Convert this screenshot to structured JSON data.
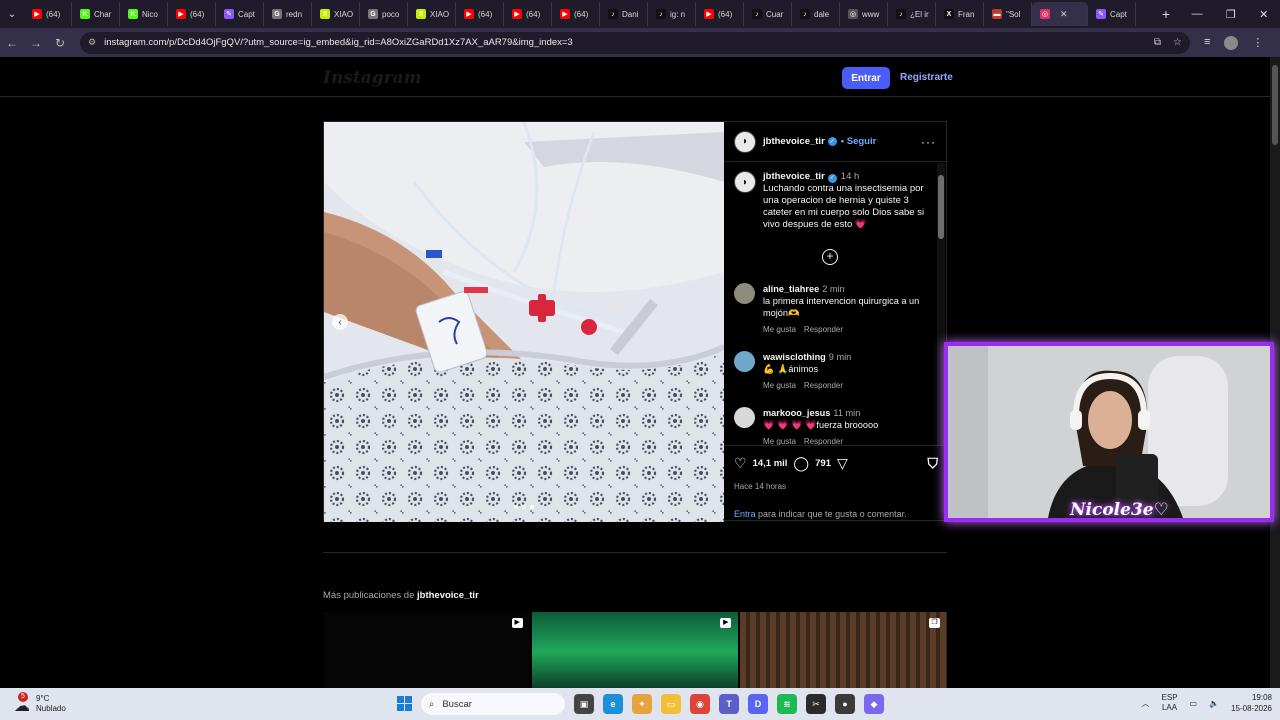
{
  "browser": {
    "tabs": [
      {
        "label": "(64)",
        "color": "#ff0000",
        "glyph": "▶"
      },
      {
        "label": "Char",
        "color": "#53fc18",
        "glyph": "K"
      },
      {
        "label": "Nico",
        "color": "#53fc18",
        "glyph": "K"
      },
      {
        "label": "(64)",
        "color": "#ff0000",
        "glyph": "▶"
      },
      {
        "label": "Capt",
        "color": "#8a5cf6",
        "glyph": "✎"
      },
      {
        "label": "redn",
        "color": "#777777",
        "glyph": "G"
      },
      {
        "label": "XIAO",
        "color": "#c3f000",
        "glyph": "X"
      },
      {
        "label": "poco",
        "color": "#777777",
        "glyph": "G"
      },
      {
        "label": "XIAO",
        "color": "#c3f000",
        "glyph": "X"
      },
      {
        "label": "(64)",
        "color": "#ff0000",
        "glyph": "▶"
      },
      {
        "label": "(64)",
        "color": "#ff0000",
        "glyph": "▶"
      },
      {
        "label": "(64)",
        "color": "#ff0000",
        "glyph": "▶"
      },
      {
        "label": "Dani",
        "color": "#111111",
        "glyph": "♪"
      },
      {
        "label": "ig: n",
        "color": "#111111",
        "glyph": "♪"
      },
      {
        "label": "(64)",
        "color": "#ff0000",
        "glyph": "▶"
      },
      {
        "label": "Cuar",
        "color": "#111111",
        "glyph": "♪"
      },
      {
        "label": "dale",
        "color": "#111111",
        "glyph": "♪"
      },
      {
        "label": "www",
        "color": "#555555",
        "glyph": "◎"
      },
      {
        "label": "¿El ir",
        "color": "#111111",
        "glyph": "♪"
      },
      {
        "label": "Fran",
        "color": "#111111",
        "glyph": "X"
      },
      {
        "label": "\"Sol",
        "color": "#c0392b",
        "glyph": "▬"
      },
      {
        "label": "",
        "color": "#e1306c",
        "glyph": "◎",
        "active": true
      },
      {
        "label": "Capt",
        "color": "#8a5cf6",
        "glyph": "✎"
      }
    ],
    "url": "instagram.com/p/DcDd4OjFgQV/?utm_source=ig_embed&ig_rid=A8OxiZGaRDd1Xz7AX_aAR79&img_index=3"
  },
  "ig": {
    "logo": "Instagram",
    "login": "Entrar",
    "signup": "Registrarte",
    "post": {
      "username": "jbthevoice_tir",
      "follow": "• Seguir",
      "caption": "Luchando  contra una insectisemia por una operacion de hernia y quiste  3 cateter en mi cuerpo solo Dios sabe si vivo despues de esto 💗",
      "caption_time": "14 h",
      "comments": [
        {
          "user": "aline_tiahree",
          "time": "2 min",
          "text": "la primera intervencion quirurgica a un mojón🫶",
          "like": "Me gusta",
          "reply": "Responder",
          "color": "#8c8c7a"
        },
        {
          "user": "wawisclothing",
          "time": "9 min",
          "text": "💪 🙏ánimos",
          "like": "Me gusta",
          "reply": "Responder",
          "color": "#6fa9c9"
        },
        {
          "user": "markooo_jesus",
          "time": "11 min",
          "text": "💗 💗 💗 💗fuerza brooooo",
          "like": "Me gusta",
          "reply": "Responder",
          "color": "#d8d8d8"
        }
      ],
      "likes": "14,1 mil",
      "comments_count": "791",
      "ago": "Hace 14 horas",
      "login_link": "Entra",
      "login_text": " para indicar que te gusta o comentar."
    },
    "more": {
      "prefix": "Más publicaciones de ",
      "user": "jbthevoice_tir"
    }
  },
  "stream": {
    "name": "Nicole3e♡"
  },
  "taskbar": {
    "temp": "9°C",
    "weather": "Nublado",
    "weather_badge": "5",
    "search": "Buscar",
    "lang1": "ESP",
    "lang2": "LAA",
    "time": "19:08",
    "date": "15-08-2026"
  }
}
